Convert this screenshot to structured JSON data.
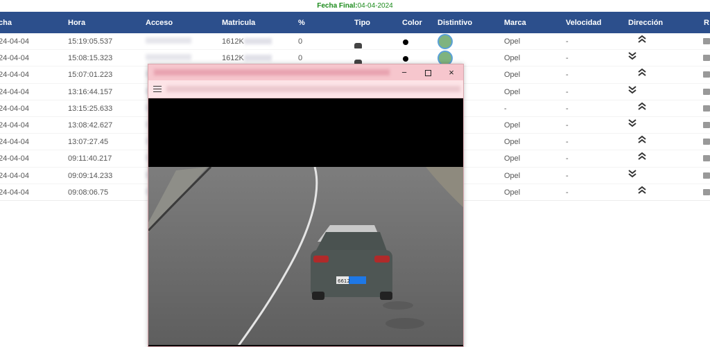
{
  "filter": {
    "label": "Fecha Final:",
    "value": "04-04-2024"
  },
  "columns": [
    "cha",
    "Hora",
    "Acceso",
    "Matricula",
    "%",
    "Tipo",
    "Color",
    "Distintivo",
    "Marca",
    "Velocidad",
    "Dirección",
    "R"
  ],
  "rows": [
    {
      "fecha": "24-04-04",
      "hora": "15:19:05.537",
      "acceso": "",
      "matricula": "1612K",
      "pct": "0",
      "marca": "Opel",
      "velocidad": "-",
      "direccion": "up"
    },
    {
      "fecha": "24-04-04",
      "hora": "15:08:15.323",
      "acceso": "",
      "matricula": "1612K",
      "pct": "0",
      "marca": "Opel",
      "velocidad": "-",
      "direccion": "down"
    },
    {
      "fecha": "24-04-04",
      "hora": "15:07:01.223",
      "acceso": "",
      "matricula": "",
      "pct": "",
      "marca": "Opel",
      "velocidad": "-",
      "direccion": "up"
    },
    {
      "fecha": "24-04-04",
      "hora": "13:16:44.157",
      "acceso": "",
      "matricula": "",
      "pct": "",
      "marca": "Opel",
      "velocidad": "-",
      "direccion": "down"
    },
    {
      "fecha": "24-04-04",
      "hora": "13:15:25.633",
      "acceso": "",
      "matricula": "",
      "pct": "",
      "marca": "-",
      "velocidad": "-",
      "direccion": "up"
    },
    {
      "fecha": "24-04-04",
      "hora": "13:08:42.627",
      "acceso": "",
      "matricula": "",
      "pct": "",
      "marca": "Opel",
      "velocidad": "-",
      "direccion": "down"
    },
    {
      "fecha": "24-04-04",
      "hora": "13:07:27.45",
      "acceso": "",
      "matricula": "",
      "pct": "",
      "marca": "Opel",
      "velocidad": "-",
      "direccion": "up"
    },
    {
      "fecha": "24-04-04",
      "hora": "09:11:40.217",
      "acceso": "",
      "matricula": "",
      "pct": "",
      "marca": "Opel",
      "velocidad": "-",
      "direccion": "up"
    },
    {
      "fecha": "24-04-04",
      "hora": "09:09:14.233",
      "acceso": "",
      "matricula": "",
      "pct": "",
      "marca": "Opel",
      "velocidad": "-",
      "direccion": "down"
    },
    {
      "fecha": "24-04-04",
      "hora": "09:08:06.75",
      "acceso": "",
      "matricula": "",
      "pct": "",
      "marca": "Opel",
      "velocidad": "-",
      "direccion": "up"
    }
  ],
  "icons": {
    "tipo": "car-icon",
    "color": "black-dot",
    "distintivo": "eco-label-icon",
    "up": "chevron-up-icon",
    "down": "chevron-down-icon",
    "r": "camera-icon"
  },
  "popup": {
    "min": "−",
    "close": "×",
    "plate": "6612"
  },
  "colors": {
    "header_bg": "#2c4f8c",
    "filter_text": "#1a8a1a",
    "popup_title": "#f6c6cd",
    "popup_bar": "#fde4e7"
  }
}
